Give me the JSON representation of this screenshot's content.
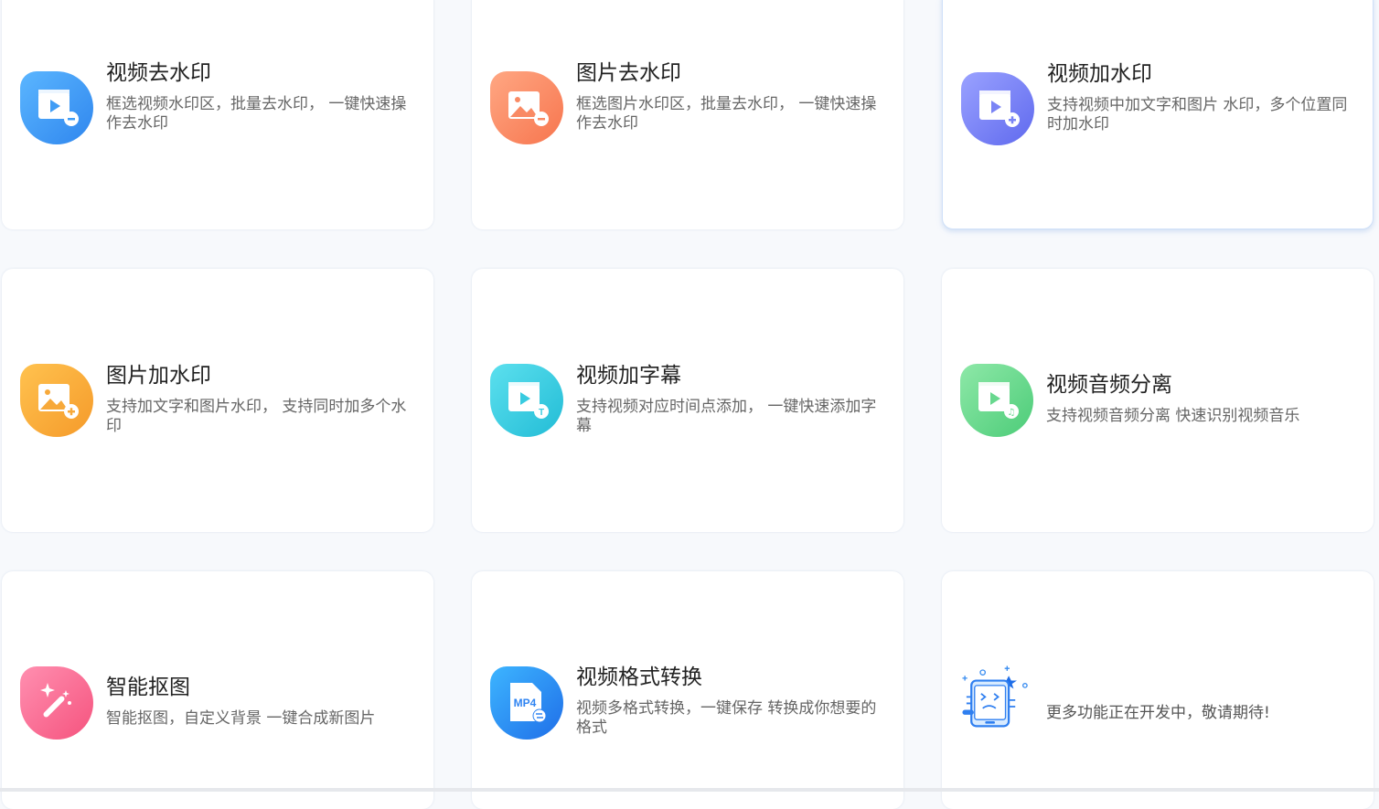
{
  "cards": [
    {
      "title": "视频去水印",
      "desc": "框选视频水印区，批量去水印， 一键快速操作去水印",
      "icon": "video-remove-watermark-icon",
      "color": "#3f9cf5"
    },
    {
      "title": "图片去水印",
      "desc": "框选图片水印区，批量去水印， 一键快速操作去水印",
      "icon": "image-remove-watermark-icon",
      "color": "#f98a64"
    },
    {
      "title": "视频加水印",
      "desc": "支持视频中加文字和图片 水印，多个位置同时加水印",
      "icon": "video-add-watermark-icon",
      "color": "#7a84f5"
    },
    {
      "title": "图片加水印",
      "desc": "支持加文字和图片水印， 支持同时加多个水印",
      "icon": "image-add-watermark-icon",
      "color": "#f7a93a"
    },
    {
      "title": "视频加字幕",
      "desc": "支持视频对应时间点添加， 一键快速添加字幕",
      "icon": "video-subtitle-icon",
      "color": "#38cbe0"
    },
    {
      "title": "视频音频分离",
      "desc": "支持视频音频分离 快速识别视频音乐",
      "icon": "video-audio-separate-icon",
      "color": "#68d88e"
    },
    {
      "title": "智能抠图",
      "desc": "智能抠图，自定义背景 一键合成新图片",
      "icon": "magic-wand-icon",
      "color": "#fa6b95"
    },
    {
      "title": "视频格式转换",
      "desc": "视频多格式转换，一键保存 转换成你想要的格式",
      "icon": "mp4-convert-icon",
      "color": "#2f84f2",
      "badge": "MP4"
    }
  ],
  "more": {
    "text": "更多功能正在开发中，敬请期待!",
    "icon": "under-construction-icon"
  }
}
